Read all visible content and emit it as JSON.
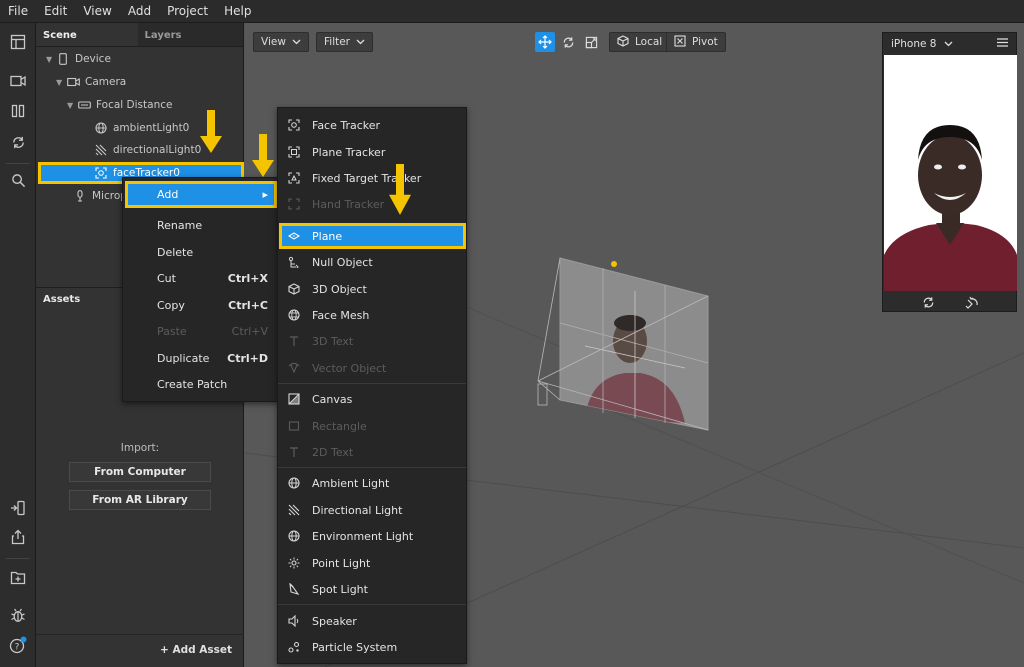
{
  "menu": [
    "File",
    "Edit",
    "View",
    "Add",
    "Project",
    "Help"
  ],
  "scene_panel": {
    "tabs": [
      "Scene",
      "Layers"
    ],
    "tree": [
      {
        "label": "Device",
        "icon": "phone-icon"
      },
      {
        "label": "Camera",
        "icon": "camera-icon"
      },
      {
        "label": "Focal Distance",
        "icon": "focal-distance-icon"
      },
      {
        "label": "ambientLight0",
        "icon": "globe-light-icon"
      },
      {
        "label": "directionalLight0",
        "icon": "directional-light-icon"
      },
      {
        "label": "faceTracker0",
        "icon": "face-tracker-icon"
      },
      {
        "label": "Microp",
        "icon": "microphone-icon"
      }
    ]
  },
  "assets_panel": {
    "title": "Assets",
    "import_label": "Import:",
    "from_computer": "From Computer",
    "from_ar_library": "From AR Library",
    "add_asset": "+ Add Asset"
  },
  "viewport": {
    "view_label": "View",
    "filter_label": "Filter",
    "local_label": "Local",
    "pivot_label": "Pivot"
  },
  "context_menu": {
    "items": [
      {
        "label": "Add",
        "shortcut": "▸",
        "disabled": false
      },
      {
        "label": "Rename",
        "shortcut": "",
        "disabled": false
      },
      {
        "label": "Delete",
        "shortcut": "",
        "disabled": false
      },
      {
        "label": "Cut",
        "shortcut": "Ctrl+X",
        "disabled": false
      },
      {
        "label": "Copy",
        "shortcut": "Ctrl+C",
        "disabled": false
      },
      {
        "label": "Paste",
        "shortcut": "Ctrl+V",
        "disabled": true
      },
      {
        "label": "Duplicate",
        "shortcut": "Ctrl+D",
        "disabled": false
      },
      {
        "label": "Create Patch",
        "shortcut": "",
        "disabled": false
      }
    ]
  },
  "add_submenu": {
    "items": [
      {
        "label": "Face Tracker",
        "disabled": false,
        "icon": "face-tracker-icon"
      },
      {
        "label": "Plane Tracker",
        "disabled": false,
        "icon": "plane-tracker-icon"
      },
      {
        "label": "Fixed Target Tracker",
        "disabled": false,
        "icon": "target-tracker-icon"
      },
      {
        "label": "Hand Tracker",
        "disabled": true,
        "icon": "hand-tracker-icon"
      },
      {
        "label": "Plane",
        "disabled": false,
        "icon": "plane-icon"
      },
      {
        "label": "Null Object",
        "disabled": false,
        "icon": "null-object-icon"
      },
      {
        "label": "3D Object",
        "disabled": false,
        "icon": "cube-icon"
      },
      {
        "label": "Face Mesh",
        "disabled": false,
        "icon": "face-mesh-icon"
      },
      {
        "label": "3D Text",
        "disabled": true,
        "icon": "text-icon"
      },
      {
        "label": "Vector Object",
        "disabled": true,
        "icon": "vector-icon"
      },
      {
        "label": "Canvas",
        "disabled": false,
        "icon": "canvas-icon"
      },
      {
        "label": "Rectangle",
        "disabled": true,
        "icon": "rectangle-icon"
      },
      {
        "label": "2D Text",
        "disabled": true,
        "icon": "text-icon"
      },
      {
        "label": "Ambient Light",
        "disabled": false,
        "icon": "globe-light-icon"
      },
      {
        "label": "Directional Light",
        "disabled": false,
        "icon": "directional-light-icon"
      },
      {
        "label": "Environment Light",
        "disabled": false,
        "icon": "globe-light-icon"
      },
      {
        "label": "Point Light",
        "disabled": false,
        "icon": "sun-icon"
      },
      {
        "label": "Spot Light",
        "disabled": false,
        "icon": "spotlight-icon"
      },
      {
        "label": "Speaker",
        "disabled": false,
        "icon": "speaker-icon"
      },
      {
        "label": "Particle System",
        "disabled": false,
        "icon": "particle-icon"
      }
    ]
  },
  "preview": {
    "device": "iPhone 8"
  },
  "colors": {
    "highlight": "#1e90e6",
    "annotation": "#f5c400"
  }
}
